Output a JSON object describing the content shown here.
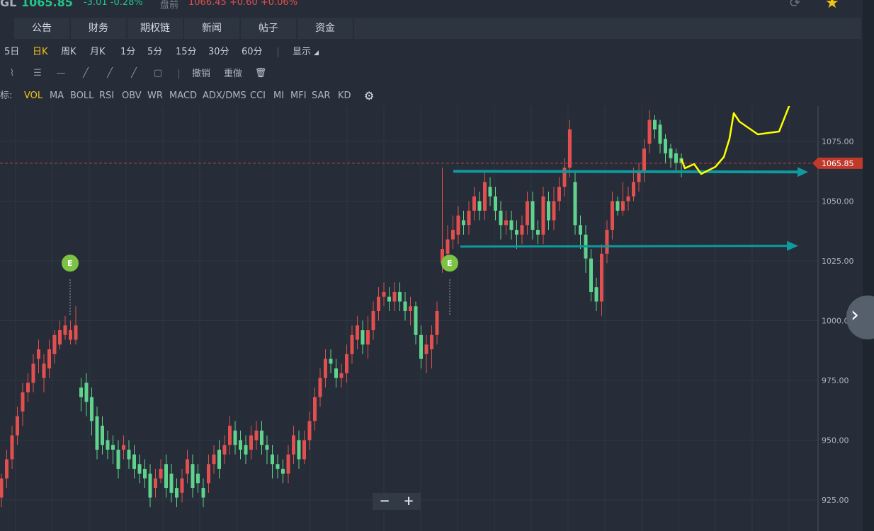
{
  "header": {
    "symbol": "GL",
    "price": "1065.85",
    "change": "-3.01 -0.28%",
    "premarket_label": "盘前",
    "premarket_value": "1066.45 +0.60 +0.06%"
  },
  "tabs": [
    "公告",
    "财务",
    "期权链",
    "新闻",
    "帖子",
    "资金"
  ],
  "periods": [
    "5日",
    "日K",
    "周K",
    "月K",
    "1分",
    "5分",
    "15分",
    "30分",
    "60分"
  ],
  "active_period": "日K",
  "display_label": "显示",
  "toolbar": {
    "undo": "撤销",
    "redo": "重做"
  },
  "indicator_prefix": "标:",
  "indicators": [
    "VOL",
    "MA",
    "BOLL",
    "RSI",
    "OBV",
    "WR",
    "MACD",
    "ADX/DMS",
    "CCI",
    "MI",
    "MFI",
    "SAR",
    "KD"
  ],
  "active_indicator": "VOL",
  "colors": {
    "up": "#e14f4f",
    "down": "#5fd38d",
    "teal_arrow": "#0e9a9e",
    "yellow_arrow": "#ffff00",
    "accent": "#f5c518",
    "bg": "#262d38"
  },
  "chart_data": {
    "type": "candlestick",
    "y_ticks": [
      "1075.00",
      "1050.00",
      "1025.00",
      "1000.00",
      "975.00",
      "950.00",
      "925.00"
    ],
    "ylim": [
      920,
      1092
    ],
    "current_price_label": "1065.85",
    "current_price": 1065.85,
    "earnings_markers": [
      "E",
      "E"
    ],
    "candles": [
      [
        926,
        934,
        922,
        936
      ],
      [
        934,
        942,
        930,
        946
      ],
      [
        942,
        952,
        938,
        956
      ],
      [
        952,
        960,
        948,
        964
      ],
      [
        962,
        970,
        956,
        974
      ],
      [
        970,
        974,
        966,
        978
      ],
      [
        974,
        982,
        970,
        986
      ],
      [
        984,
        988,
        978,
        992
      ],
      [
        976,
        982,
        970,
        986
      ],
      [
        980,
        988,
        976,
        992
      ],
      [
        986,
        994,
        982,
        996
      ],
      [
        990,
        996,
        988,
        1000
      ],
      [
        994,
        998,
        992,
        1002
      ],
      [
        992,
        996,
        990,
        1000
      ],
      [
        992,
        998,
        990,
        1006
      ],
      [
        972,
        968,
        962,
        976
      ],
      [
        974,
        966,
        960,
        978
      ],
      [
        968,
        958,
        952,
        972
      ],
      [
        960,
        946,
        942,
        964
      ],
      [
        956,
        948,
        944,
        960
      ],
      [
        950,
        946,
        942,
        954
      ],
      [
        948,
        946,
        940,
        952
      ],
      [
        946,
        938,
        934,
        950
      ],
      [
        946,
        948,
        942,
        952
      ],
      [
        946,
        942,
        938,
        950
      ],
      [
        944,
        938,
        934,
        948
      ],
      [
        940,
        936,
        932,
        944
      ],
      [
        938,
        934,
        930,
        942
      ],
      [
        936,
        926,
        922,
        940
      ],
      [
        930,
        934,
        926,
        938
      ],
      [
        934,
        938,
        932,
        942
      ],
      [
        940,
        930,
        926,
        944
      ],
      [
        936,
        928,
        924,
        940
      ],
      [
        930,
        926,
        922,
        934
      ],
      [
        928,
        934,
        924,
        938
      ],
      [
        936,
        942,
        932,
        946
      ],
      [
        940,
        930,
        926,
        944
      ],
      [
        936,
        932,
        928,
        940
      ],
      [
        930,
        926,
        922,
        934
      ],
      [
        932,
        940,
        928,
        944
      ],
      [
        940,
        944,
        936,
        948
      ],
      [
        946,
        938,
        934,
        950
      ],
      [
        944,
        948,
        940,
        952
      ],
      [
        948,
        956,
        944,
        960
      ],
      [
        954,
        948,
        944,
        958
      ],
      [
        950,
        946,
        942,
        954
      ],
      [
        948,
        944,
        940,
        952
      ],
      [
        946,
        952,
        942,
        956
      ],
      [
        950,
        954,
        946,
        958
      ],
      [
        954,
        948,
        944,
        958
      ],
      [
        948,
        946,
        940,
        952
      ],
      [
        944,
        940,
        934,
        948
      ],
      [
        940,
        938,
        934,
        944
      ],
      [
        938,
        936,
        932,
        942
      ],
      [
        936,
        944,
        932,
        948
      ],
      [
        944,
        952,
        940,
        956
      ],
      [
        950,
        942,
        938,
        954
      ],
      [
        942,
        950,
        940,
        954
      ],
      [
        950,
        958,
        946,
        962
      ],
      [
        958,
        968,
        954,
        972
      ],
      [
        968,
        976,
        964,
        980
      ],
      [
        976,
        984,
        972,
        988
      ],
      [
        984,
        982,
        978,
        988
      ],
      [
        980,
        976,
        972,
        984
      ],
      [
        976,
        978,
        972,
        982
      ],
      [
        978,
        986,
        974,
        990
      ],
      [
        986,
        994,
        982,
        998
      ],
      [
        992,
        998,
        988,
        1002
      ],
      [
        996,
        990,
        986,
        1000
      ],
      [
        990,
        996,
        984,
        1002
      ],
      [
        996,
        1004,
        992,
        1008
      ],
      [
        1004,
        1010,
        1000,
        1014
      ],
      [
        1010,
        1012,
        1006,
        1016
      ],
      [
        1010,
        1008,
        1004,
        1014
      ],
      [
        1008,
        1012,
        1004,
        1016
      ],
      [
        1012,
        1008,
        1004,
        1016
      ],
      [
        1008,
        1004,
        1000,
        1012
      ],
      [
        1004,
        1006,
        998,
        1010
      ],
      [
        1006,
        994,
        990,
        1008
      ],
      [
        994,
        984,
        980,
        998
      ],
      [
        986,
        990,
        978,
        994
      ],
      [
        988,
        994,
        980,
        998
      ],
      [
        994,
        1004,
        990,
        1008
      ],
      [
        1024,
        1030,
        1020,
        1064
      ],
      [
        1028,
        1034,
        1024,
        1040
      ],
      [
        1034,
        1038,
        1030,
        1044
      ],
      [
        1036,
        1044,
        1032,
        1048
      ],
      [
        1042,
        1040,
        1036,
        1046
      ],
      [
        1040,
        1046,
        1036,
        1050
      ],
      [
        1046,
        1052,
        1042,
        1056
      ],
      [
        1050,
        1046,
        1042,
        1054
      ],
      [
        1046,
        1058,
        1042,
        1062
      ],
      [
        1056,
        1052,
        1048,
        1060
      ],
      [
        1052,
        1046,
        1042,
        1056
      ],
      [
        1046,
        1040,
        1034,
        1050
      ],
      [
        1040,
        1042,
        1036,
        1046
      ],
      [
        1042,
        1038,
        1034,
        1046
      ],
      [
        1038,
        1036,
        1030,
        1042
      ],
      [
        1036,
        1040,
        1032,
        1044
      ],
      [
        1040,
        1050,
        1036,
        1054
      ],
      [
        1050,
        1038,
        1034,
        1054
      ],
      [
        1038,
        1036,
        1032,
        1042
      ],
      [
        1036,
        1052,
        1032,
        1056
      ],
      [
        1050,
        1042,
        1038,
        1054
      ],
      [
        1042,
        1050,
        1038,
        1056
      ],
      [
        1050,
        1056,
        1046,
        1060
      ],
      [
        1056,
        1064,
        1052,
        1068
      ],
      [
        1064,
        1080,
        1060,
        1084
      ],
      [
        1058,
        1040,
        1036,
        1062
      ],
      [
        1040,
        1036,
        1030,
        1044
      ],
      [
        1036,
        1026,
        1020,
        1040
      ],
      [
        1026,
        1012,
        1008,
        1030
      ],
      [
        1014,
        1008,
        1004,
        1018
      ],
      [
        1008,
        1028,
        1002,
        1032
      ],
      [
        1028,
        1038,
        1024,
        1042
      ],
      [
        1038,
        1050,
        1034,
        1054
      ],
      [
        1050,
        1046,
        1044,
        1052
      ],
      [
        1046,
        1050,
        1044,
        1058
      ],
      [
        1050,
        1052,
        1046,
        1056
      ],
      [
        1052,
        1058,
        1050,
        1064
      ],
      [
        1058,
        1062,
        1054,
        1066
      ],
      [
        1062,
        1072,
        1058,
        1076
      ],
      [
        1074,
        1084,
        1070,
        1088
      ],
      [
        1084,
        1080,
        1076,
        1086
      ],
      [
        1082,
        1074,
        1070,
        1084
      ],
      [
        1076,
        1070,
        1066,
        1078
      ],
      [
        1072,
        1068,
        1064,
        1074
      ],
      [
        1070,
        1066,
        1062,
        1072
      ],
      [
        1068,
        1066,
        1060,
        1070
      ]
    ],
    "annotation_levels": [
      1062.5,
      1031
    ]
  }
}
